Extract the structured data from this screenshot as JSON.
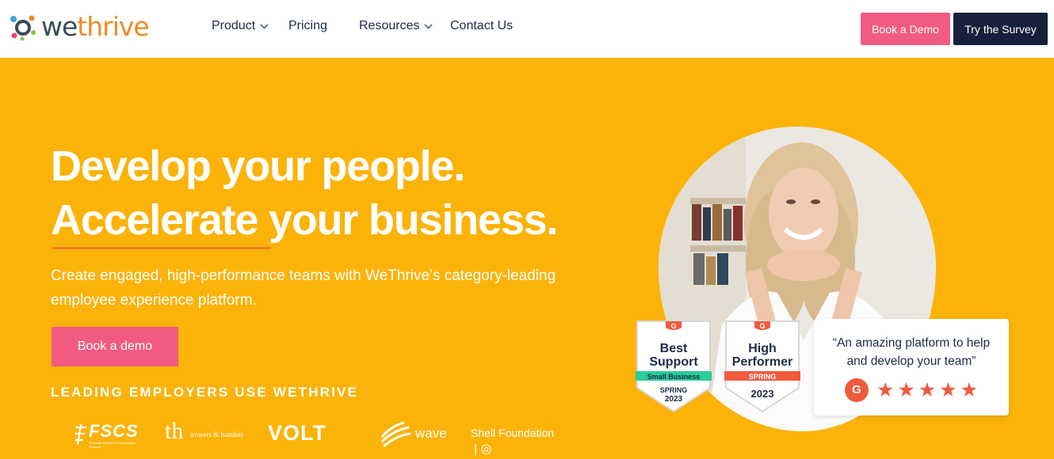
{
  "nav": {
    "logo_we": "we",
    "logo_thrive": "thrive",
    "items": [
      {
        "label": "Product",
        "has_dropdown": true
      },
      {
        "label": "Pricing",
        "has_dropdown": false
      },
      {
        "label": "Resources",
        "has_dropdown": true
      },
      {
        "label": "Contact Us",
        "has_dropdown": false
      }
    ],
    "book_demo": "Book a Demo",
    "try_survey": "Try the Survey"
  },
  "hero": {
    "headline_line1": "Develop your people.",
    "headline_line2": "Accelerate your business.",
    "subtext": "Create engaged, high-performance teams with WeThrive’s category-leading employee experience platform.",
    "cta": "Book a demo",
    "leading_employers": "LEADING EMPLOYERS USE WETHRIVE"
  },
  "client_logos": {
    "fscs": "FSCS",
    "fscs_sub": "Financial Services Compensation Scheme",
    "th": "th",
    "th_name": "trowers & hamlins",
    "volt": "VOLT",
    "wave": "wave",
    "shell": "Shell Foundation"
  },
  "badges": [
    {
      "line1": "Best",
      "line2": "Support",
      "ribbon": "Small Business",
      "season": "SPRING",
      "year": "2023",
      "ribbon_color": "#2BCB9A"
    },
    {
      "line1": "High",
      "line2": "Performer",
      "ribbon": "SPRING",
      "season": "",
      "year": "2023",
      "ribbon_color": "#F05A3D"
    }
  ],
  "review": {
    "quote": "“An amazing platform to help and develop your team”",
    "g2_label": "G",
    "rating": 5
  },
  "colors": {
    "hero_bg": "#FBB309",
    "brand_pink": "#F15B7F",
    "navy": "#16203A",
    "orange": "#F08A24",
    "g2_red": "#F05A3D"
  }
}
